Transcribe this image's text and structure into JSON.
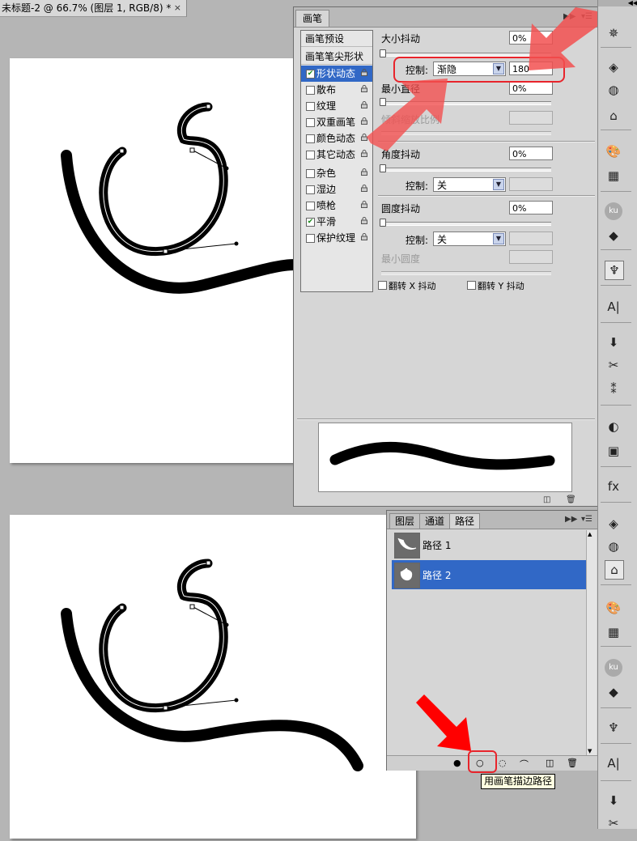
{
  "document": {
    "tab_title": "未标题-2 @ 66.7% (图层 1, RGB/8) *",
    "close_glyph": "×"
  },
  "brush_panel": {
    "tab": "画笔",
    "list": {
      "presets_label": "画笔预设",
      "tip_shape_label": "画笔笔尖形状",
      "items": [
        {
          "label": "形状动态",
          "checked": true,
          "selected": true
        },
        {
          "label": "散布",
          "checked": false,
          "selected": false
        },
        {
          "label": "纹理",
          "checked": false,
          "selected": false
        },
        {
          "label": "双重画笔",
          "checked": false,
          "selected": false
        },
        {
          "label": "颜色动态",
          "checked": false,
          "selected": false
        },
        {
          "label": "其它动态",
          "checked": false,
          "selected": false
        },
        {
          "label": "杂色",
          "checked": false,
          "selected": false
        },
        {
          "label": "湿边",
          "checked": false,
          "selected": false
        },
        {
          "label": "喷枪",
          "checked": false,
          "selected": false
        },
        {
          "label": "平滑",
          "checked": true,
          "selected": false
        },
        {
          "label": "保护纹理",
          "checked": false,
          "selected": false
        }
      ]
    },
    "size_jitter": {
      "label": "大小抖动",
      "value": "0%",
      "control_label": "控制:",
      "control_value": "渐隐",
      "fade_steps": "180"
    },
    "min_diameter": {
      "label": "最小直径",
      "value": "0%"
    },
    "tilt_scale": {
      "label": "倾斜缩放比例"
    },
    "angle_jitter": {
      "label": "角度抖动",
      "value": "0%",
      "control_label": "控制:",
      "control_value": "关"
    },
    "roundness_jitter": {
      "label": "圆度抖动",
      "value": "0%",
      "control_label": "控制:",
      "control_value": "关"
    },
    "min_roundness": {
      "label": "最小圆度"
    },
    "flip_x": "翻转 X 抖动",
    "flip_y": "翻转 Y 抖动"
  },
  "paths_panel": {
    "tabs": [
      "图层",
      "通道",
      "路径"
    ],
    "active_tab": 2,
    "paths": [
      {
        "name": "路径 1",
        "selected": false
      },
      {
        "name": "路径 2",
        "selected": true
      }
    ],
    "tooltip": "用画笔描边路径"
  },
  "dock": {
    "icons": [
      "navigator-icon",
      "layers-icon",
      "channels-icon",
      "paths-icon",
      "swatches-icon",
      "grid-icon",
      "kuler-icon",
      "fill-icon",
      "brush-icon",
      "character-icon",
      "stamp-icon",
      "tools-icon",
      "actions-icon",
      "circle-icon",
      "mask-icon",
      "fx-icon"
    ]
  },
  "colors": {
    "selection": "#3168c6",
    "annotation_red": "#e8242b",
    "panel_bg": "#d6d6d6"
  }
}
